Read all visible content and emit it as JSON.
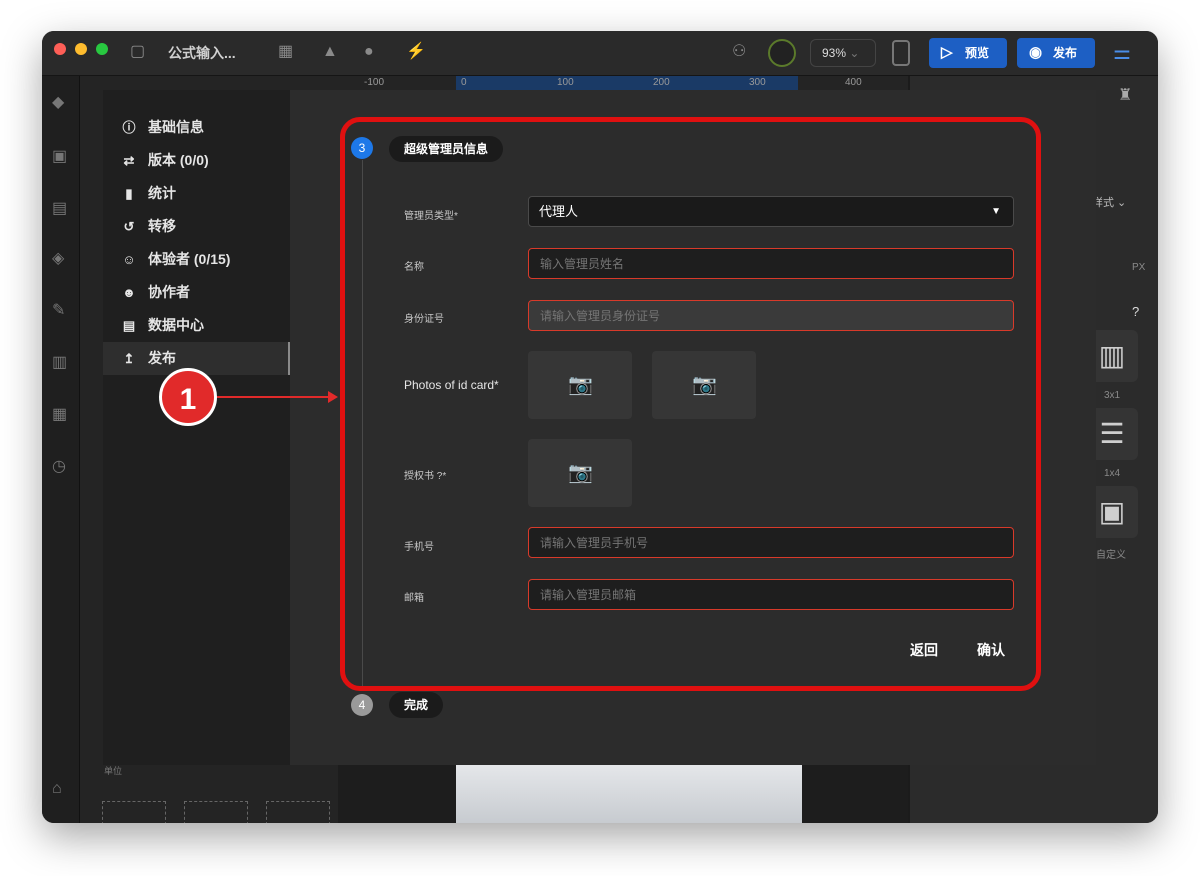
{
  "app": {
    "title": "公式输入...",
    "zoom": "93%",
    "preview_label": "预览",
    "publish_label": "发布"
  },
  "ruler": [
    "-100",
    "0",
    "100",
    "200",
    "300",
    "400"
  ],
  "right_panel": {
    "style_label": "样式",
    "unit": "PX",
    "layouts": [
      "3x1",
      "1x4",
      "自定义"
    ]
  },
  "bottom": {
    "label": "单位"
  },
  "menu": {
    "items": [
      {
        "label": "基础信息",
        "icon": "info-icon"
      },
      {
        "label": "版本 (0/0)",
        "icon": "version-icon"
      },
      {
        "label": "统计",
        "icon": "stats-icon"
      },
      {
        "label": "转移",
        "icon": "transfer-icon"
      },
      {
        "label": "体验者 (0/15)",
        "icon": "tester-icon"
      },
      {
        "label": "协作者",
        "icon": "collaborator-icon"
      },
      {
        "label": "数据中心",
        "icon": "datacenter-icon"
      },
      {
        "label": "发布",
        "icon": "publish-icon"
      }
    ],
    "active_index": 7
  },
  "annotation": {
    "badge": "1",
    "color": "#e12a2a"
  },
  "steps": [
    {
      "number": "3",
      "label": "超级管理员信息",
      "color": "#1d78e8"
    },
    {
      "number": "4",
      "label": "完成",
      "color": "#9a9a9a"
    }
  ],
  "form": {
    "admin_type": {
      "label": "管理员类型*",
      "value": "代理人"
    },
    "name": {
      "label": "名称",
      "placeholder": "输入管理员姓名"
    },
    "id_number": {
      "label": "身份证号",
      "placeholder": "请输入管理员身份证号"
    },
    "id_photos": {
      "label": "Photos of id card*"
    },
    "authorization": {
      "label": "授权书 ?*"
    },
    "phone": {
      "label": "手机号",
      "placeholder": "请输入管理员手机号"
    },
    "email": {
      "label": "邮箱",
      "placeholder": "请输入管理员邮箱"
    },
    "back_label": "返回",
    "confirm_label": "确认"
  }
}
